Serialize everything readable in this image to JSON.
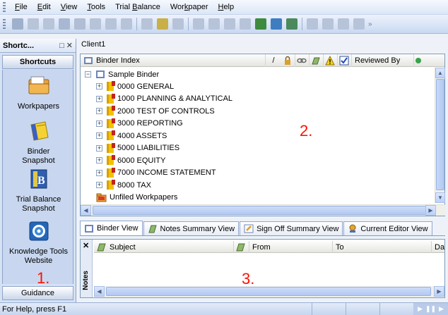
{
  "menubar": {
    "items": [
      "File",
      "Edit",
      "View",
      "Tools",
      "Trial Balance",
      "Workpaper",
      "Help"
    ],
    "underline": [
      "F",
      "E",
      "V",
      "T",
      "B",
      "k",
      "H"
    ]
  },
  "shortcuts": {
    "pane_title": "Shortc...",
    "pane_buttons": "□ ✕",
    "header": "Shortcuts",
    "items": [
      {
        "label": "Workpapers",
        "icon": "workpapers-icon"
      },
      {
        "label": "Binder Snapshot",
        "icon": "binder-snapshot-icon"
      },
      {
        "label": "Trial Balance Snapshot",
        "icon": "trial-balance-snapshot-icon"
      },
      {
        "label": "Knowledge Tools Website",
        "icon": "knowledge-tools-icon"
      }
    ],
    "footer": "Guidance"
  },
  "document": {
    "tab": "Client1"
  },
  "binder": {
    "headers": {
      "index": "Binder Index",
      "slash": "/",
      "reviewed_by": "Reviewed By"
    },
    "root": "Sample Binder",
    "sections": [
      "0000 GENERAL",
      "1000 PLANNING & ANALYTICAL",
      "2000 TEST OF CONTROLS",
      "3000 REPORTING",
      "4000 ASSETS",
      "5000 LIABILITIES",
      "6000 EQUITY",
      "7000 INCOME STATEMENT",
      "8000 TAX"
    ],
    "unfiled": "Unfiled Workpapers"
  },
  "view_tabs": [
    "Binder View",
    "Notes Summary View",
    "Sign Off Summary View",
    "Current Editor View"
  ],
  "notes": {
    "panel_label": "Notes",
    "close": "✕",
    "columns": [
      "Subject",
      "From",
      "To",
      "Da"
    ]
  },
  "status": {
    "text": "For Help, press F1"
  },
  "annotations": [
    "1.",
    "2.",
    "3."
  ],
  "colors": {
    "annotation": "#ff1100",
    "toolbar": "#c9d9f1",
    "folder_tab": "#f2c200"
  }
}
